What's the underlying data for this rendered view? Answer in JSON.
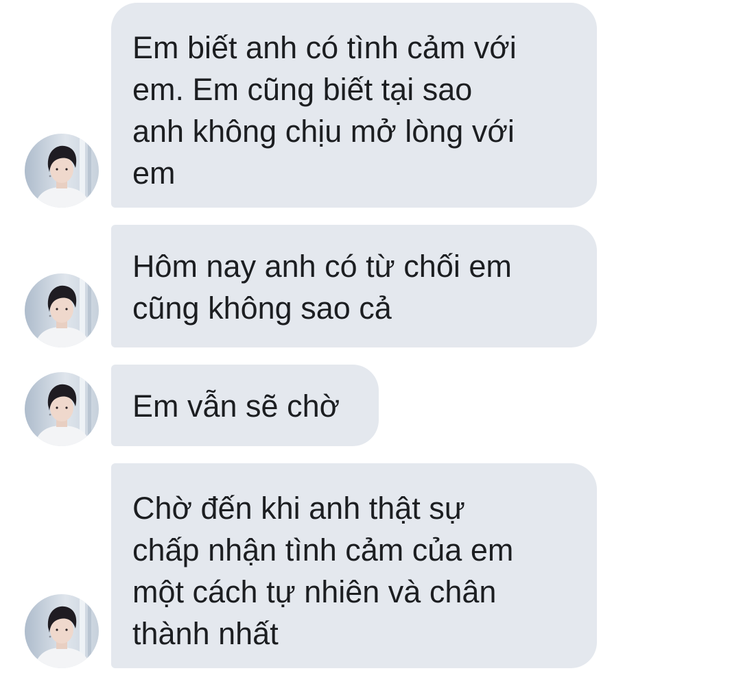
{
  "conversation": {
    "messages": [
      {
        "text": "Em biết anh có tình cảm với\nem. Em cũng biết tại sao\nanh không chịu mở lòng với\nem"
      },
      {
        "text": "Hôm nay anh có từ chối em\ncũng không sao cả"
      },
      {
        "text": "Em vẫn sẽ chờ"
      },
      {
        "text": "Chờ đến khi anh thật sự\nchấp nhận tình cảm của em\nmột cách tự nhiên và chân\nthành nhất"
      }
    ],
    "sender_avatar_icon": "contact-avatar-photo",
    "bubble_color": "#e4e8ee",
    "text_color": "#1c1e21"
  }
}
